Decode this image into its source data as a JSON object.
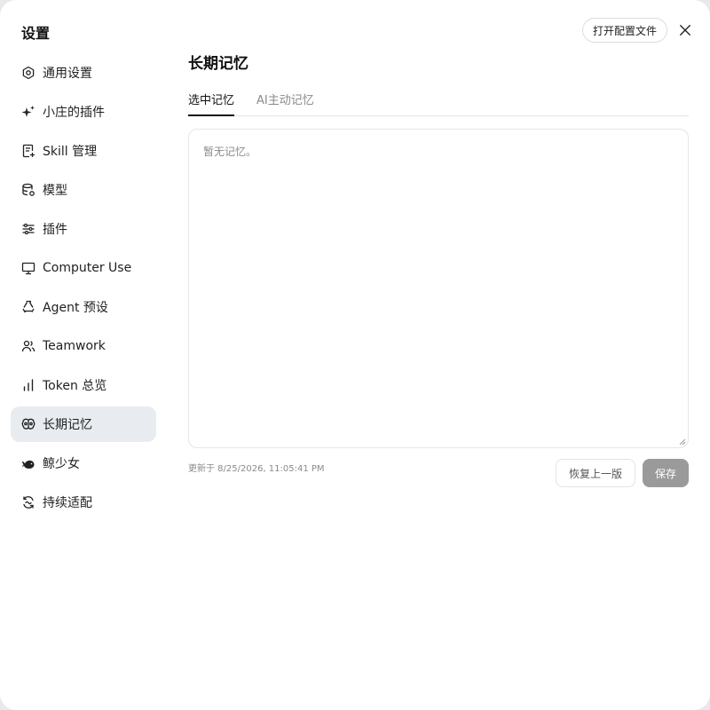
{
  "sidebar": {
    "title": "设置",
    "items": [
      {
        "label": "通用设置",
        "icon": "gear-icon"
      },
      {
        "label": "小庄的插件",
        "icon": "sparkle-icon"
      },
      {
        "label": "Skill 管理",
        "icon": "skill-doc-icon"
      },
      {
        "label": "模型",
        "icon": "database-icon"
      },
      {
        "label": "插件",
        "icon": "sliders-icon"
      },
      {
        "label": "Computer Use",
        "icon": "monitor-icon"
      },
      {
        "label": "Agent 预设",
        "icon": "agent-recycle-icon"
      },
      {
        "label": "Teamwork",
        "icon": "users-icon"
      },
      {
        "label": "Token 总览",
        "icon": "bar-chart-icon"
      },
      {
        "label": "长期记忆",
        "icon": "memory-brain-icon",
        "active": true
      },
      {
        "label": "鲸少女",
        "icon": "whale-icon"
      },
      {
        "label": "持续适配",
        "icon": "adapt-icon"
      }
    ]
  },
  "header": {
    "open_config_label": "打开配置文件",
    "close_icon": "close-icon"
  },
  "main": {
    "title": "长期记忆",
    "tabs": [
      {
        "label": "选中记忆",
        "active": true
      },
      {
        "label": "AI主动记忆",
        "active": false
      }
    ],
    "memory_text": "暂无记忆。",
    "updated_text": "更新于 8/25/2026, 11:05:41 PM",
    "restore_label": "恢复上一版",
    "save_label": "保存"
  },
  "colors": {
    "active_nav_bg": "#e8ebef",
    "save_button_bg": "#9a9a9a",
    "muted_text": "#8a8a8a"
  }
}
